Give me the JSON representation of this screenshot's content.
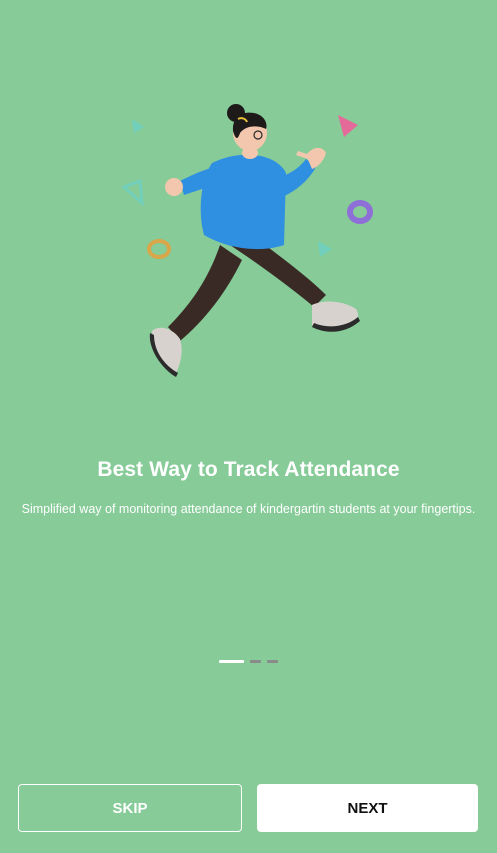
{
  "onboarding": {
    "title": "Best Way to Track Attendance",
    "subtitle": "Simplified way of monitoring attendance of kindergartin students at your fingertips.",
    "page_indicator": {
      "current": 1,
      "total": 3
    }
  },
  "actions": {
    "skip_label": "SKIP",
    "next_label": "NEXT"
  },
  "illustration": {
    "name": "running-person-illustration"
  },
  "colors": {
    "background": "#86cb98",
    "shirt": "#2f8fe0",
    "pants": "#3a2a25",
    "button_text": "#111111"
  }
}
